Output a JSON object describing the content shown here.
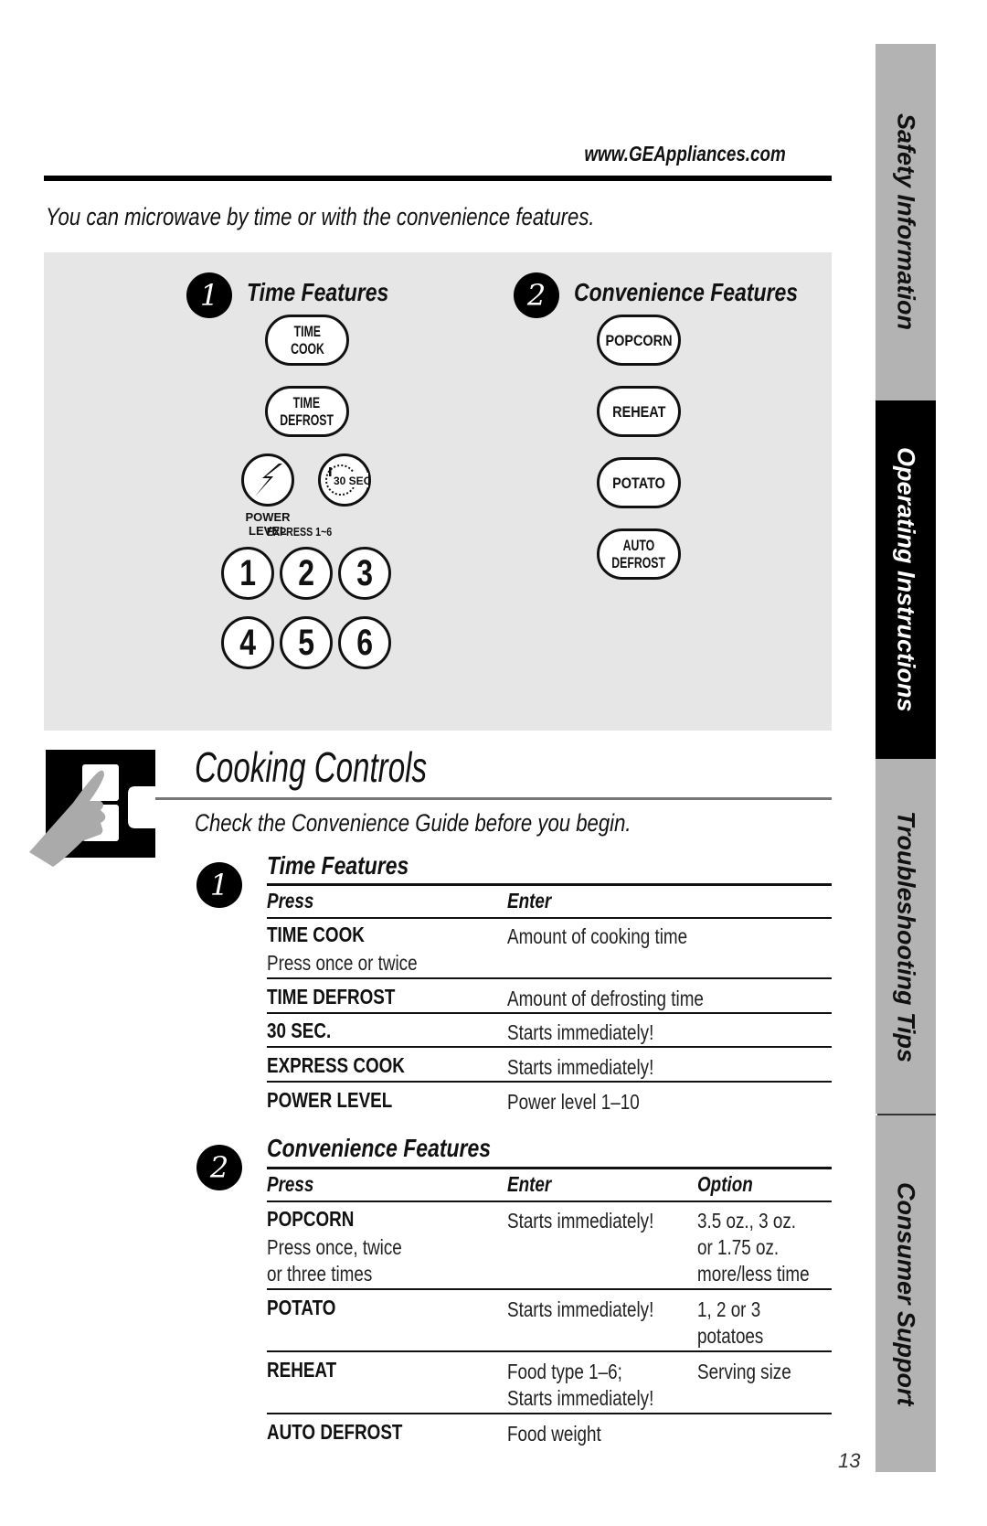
{
  "header": {
    "url": "www.GEAppliances.com",
    "intro": "You can microwave by time or with the convenience features."
  },
  "panel": {
    "time_features": {
      "number": "1",
      "heading": "Time Features",
      "buttons": [
        {
          "line1": "TIME",
          "line2": "COOK"
        },
        {
          "line1": "TIME",
          "line2": "DEFROST"
        }
      ],
      "power_level_label_1": "POWER",
      "power_level_label_2": "LEVEL",
      "thirty_sec_label": "30 SEC",
      "express_label": "EXPRESS 1~6",
      "number_buttons": [
        "1",
        "2",
        "3",
        "4",
        "5",
        "6"
      ]
    },
    "convenience_features": {
      "number": "2",
      "heading": "Convenience Features",
      "buttons": [
        {
          "line1": "POPCORN",
          "line2": ""
        },
        {
          "line1": "REHEAT",
          "line2": ""
        },
        {
          "line1": "POTATO",
          "line2": ""
        },
        {
          "line1": "AUTO",
          "line2": "DEFROST"
        }
      ]
    }
  },
  "section": {
    "title": "Cooking Controls",
    "subtitle": "Check the Convenience Guide before you begin."
  },
  "time_table": {
    "number": "1",
    "heading": "Time Features",
    "columns": [
      "Press",
      "Enter"
    ],
    "rows": [
      {
        "press": "TIME COOK",
        "press_note": "Press once or twice",
        "enter": "Amount of cooking time"
      },
      {
        "press": "TIME DEFROST",
        "press_note": "",
        "enter": "Amount of defrosting time"
      },
      {
        "press": "30 SEC.",
        "press_note": "",
        "enter": "Starts immediately!"
      },
      {
        "press": "EXPRESS COOK",
        "press_note": "",
        "enter": "Starts immediately!"
      },
      {
        "press": "POWER LEVEL",
        "press_note": "",
        "enter": "Power level 1–10"
      }
    ]
  },
  "convenience_table": {
    "number": "2",
    "heading": "Convenience Features",
    "columns": [
      "Press",
      "Enter",
      "Option"
    ],
    "rows": [
      {
        "press": "POPCORN",
        "press_note_1": "Press once, twice",
        "press_note_2": "or three times",
        "enter_1": "Starts immediately!",
        "enter_2": "",
        "option_1": "3.5 oz., 3 oz.",
        "option_2": "or 1.75 oz.",
        "option_3": "more/less time"
      },
      {
        "press": "POTATO",
        "enter_1": "Starts immediately!",
        "enter_2": "",
        "option_1": "1, 2 or 3",
        "option_2": "potatoes"
      },
      {
        "press": "REHEAT",
        "enter_1": "Food type 1–6;",
        "enter_2": "Starts immediately!",
        "option_1": "Serving size",
        "option_2": ""
      },
      {
        "press": "AUTO DEFROST",
        "enter_1": "Food weight",
        "enter_2": "",
        "option_1": "",
        "option_2": ""
      }
    ]
  },
  "side_tabs": [
    {
      "label": "Safety Information",
      "active": false
    },
    {
      "label": "Operating Instructions",
      "active": true
    },
    {
      "label": "Troubleshooting Tips",
      "active": false
    },
    {
      "label": "Consumer Support",
      "active": false
    }
  ],
  "colors": {
    "panel_bg": "#e6e6e6",
    "tab_inactive": "#b3b3b3",
    "tab_active": "#000000"
  },
  "page_number": "13"
}
